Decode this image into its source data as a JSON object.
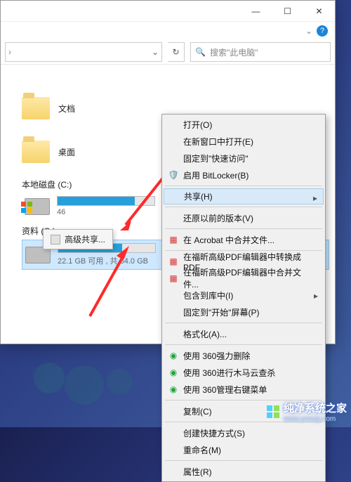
{
  "window": {
    "minimize": "—",
    "maximize": "☐",
    "close": "✕",
    "help": "?"
  },
  "search": {
    "placeholder": "搜索\"此电脑\""
  },
  "folders": {
    "documents": "文档",
    "desktop": "桌面"
  },
  "drives": {
    "c": {
      "title": "本地磁盘 (C:)",
      "space": "46"
    },
    "g": {
      "title": "资料 (G:)",
      "space": "22.1 GB 可用 , 共 64.0 GB"
    }
  },
  "flyout": {
    "label": "高级共享..."
  },
  "ctx": {
    "open": "打开(O)",
    "newwin": "在新窗口中打开(E)",
    "pin": "固定到\"快速访问\"",
    "bitlocker": "启用 BitLocker(B)",
    "share": "共享(H)",
    "restore": "还原以前的版本(V)",
    "acrobat_merge": "在 Acrobat 中合并文件...",
    "foxit_conv": "在福昕高级PDF编辑器中转换成PDF",
    "foxit_merge": "在福昕高级PDF编辑器中合并文件...",
    "library": "包含到库中(I)",
    "pinstart": "固定到\"开始\"屏幕(P)",
    "format": "格式化(A)...",
    "del360": "使用 360强力删除",
    "scan360": "使用 360进行木马云查杀",
    "mgr360": "使用 360管理右键菜单",
    "copy": "复制(C)",
    "shortcut": "创建快捷方式(S)",
    "rename": "重命名(M)",
    "props": "属性(R)"
  },
  "watermark": {
    "name": "纯净系统之家",
    "url": "www.ycwzjy.com"
  }
}
